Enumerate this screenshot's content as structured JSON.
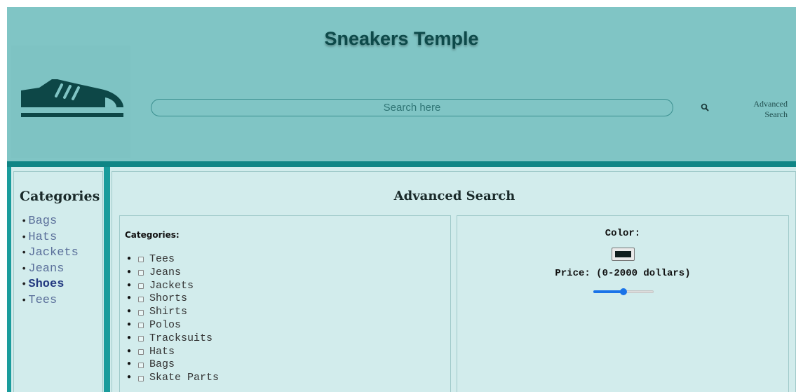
{
  "header": {
    "site_title": "Sneakers Temple",
    "logo_icon": "sneaker-icon",
    "search": {
      "placeholder": "Search here",
      "value": ""
    },
    "search_icon": "search-icon",
    "advanced_search_link": "Advanced Search"
  },
  "sidebar": {
    "title": "Categories",
    "items": [
      {
        "label": "Bags",
        "active": false
      },
      {
        "label": "Hats",
        "active": false
      },
      {
        "label": "Jackets",
        "active": false
      },
      {
        "label": "Jeans",
        "active": false
      },
      {
        "label": "Shoes",
        "active": true
      },
      {
        "label": "Tees",
        "active": false
      }
    ]
  },
  "main": {
    "title": "Advanced Search",
    "categories": {
      "label": "Categories:",
      "items": [
        "Tees",
        "Jeans",
        "Jackets",
        "Shorts",
        "Shirts",
        "Polos",
        "Tracksuits",
        "Hats",
        "Bags",
        "Skate Parts"
      ]
    },
    "filters": {
      "color_label": "Color:",
      "color_value": "#101e1e",
      "price_label": "Price: (0-2000 dollars)",
      "price_slider": {
        "min": 0,
        "max": 2000,
        "value": 1000
      }
    }
  },
  "colors": {
    "header_bg": "#80c5c5",
    "accent": "#1a9c9c",
    "panel_bg": "#d2ecec",
    "slider_accent": "#1a73e8"
  }
}
